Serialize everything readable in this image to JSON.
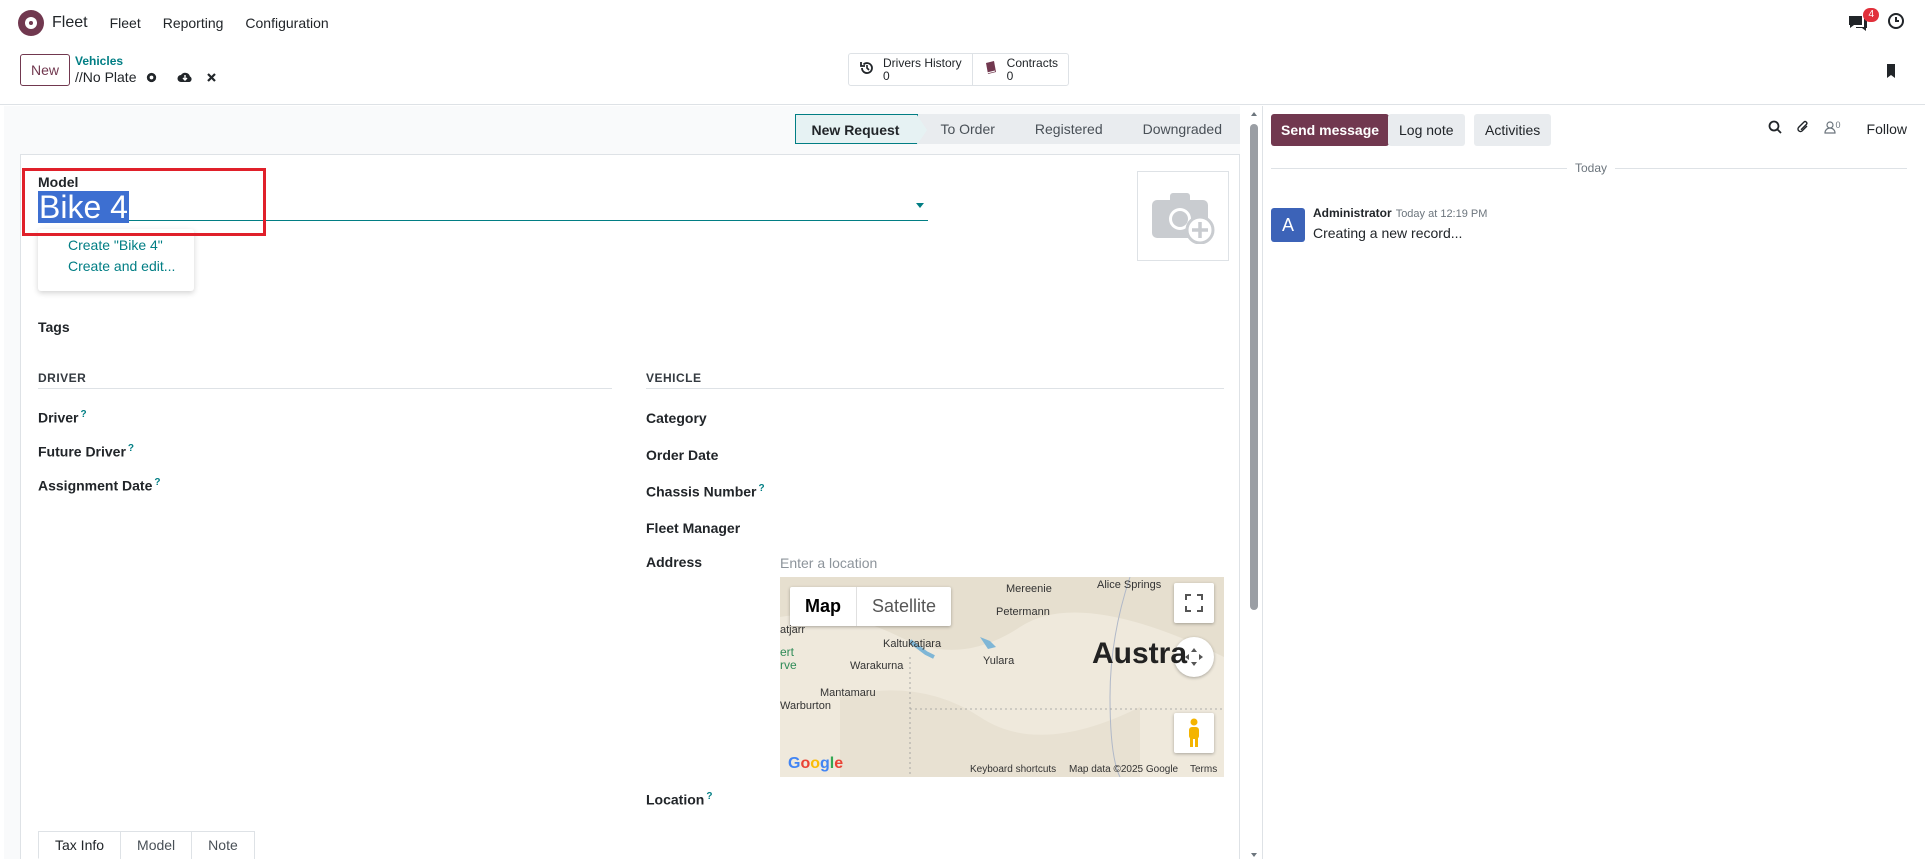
{
  "navbar": {
    "app_name": "Fleet",
    "menu": [
      "Fleet",
      "Reporting",
      "Configuration"
    ],
    "notification_count": "4"
  },
  "control_panel": {
    "new_label": "New",
    "breadcrumb": "Vehicles",
    "record_name": "//No Plate",
    "smart_buttons": [
      {
        "label": "Drivers History",
        "count": "0",
        "icon": "history-icon"
      },
      {
        "label": "Contracts",
        "count": "0",
        "icon": "book-icon"
      }
    ]
  },
  "statusbar": [
    "New Request",
    "To Order",
    "Registered",
    "Downgraded"
  ],
  "form": {
    "model_label": "Model",
    "model_value": "Bike 4",
    "autocomplete": [
      "Create \"Bike 4\"",
      "Create and edit..."
    ],
    "tags_label": "Tags",
    "driver_section": "DRIVER",
    "vehicle_section": "VEHICLE",
    "driver_fields": [
      "Driver",
      "Future Driver",
      "Assignment Date"
    ],
    "vehicle_fields": [
      "Category",
      "Order Date",
      "Chassis Number",
      "Fleet Manager"
    ],
    "address_label": "Address",
    "address_placeholder": "Enter a location",
    "location_label": "Location",
    "help_mark": "?",
    "tabs": [
      "Tax Info",
      "Model",
      "Note"
    ]
  },
  "map": {
    "type_map": "Map",
    "type_satellite": "Satellite",
    "places": [
      "Mereenie",
      "Alice Springs",
      "Petermann",
      "Kaltukatjara",
      "Yulara",
      "Warakurna",
      "Mantamaru",
      "Warburton",
      "atjarr",
      "ert",
      "rve"
    ],
    "big_label": "Austra",
    "google": "Google",
    "footer": [
      "Keyboard shortcuts",
      "Map data ©2025 Google",
      "Terms"
    ]
  },
  "chatter": {
    "send_message": "Send message",
    "log_note": "Log note",
    "activities": "Activities",
    "follower_count": "0",
    "follow": "Follow",
    "today": "Today",
    "avatar_letter": "A",
    "author": "Administrator",
    "date": "Today at 12:19 PM",
    "message": "Creating a new record..."
  }
}
